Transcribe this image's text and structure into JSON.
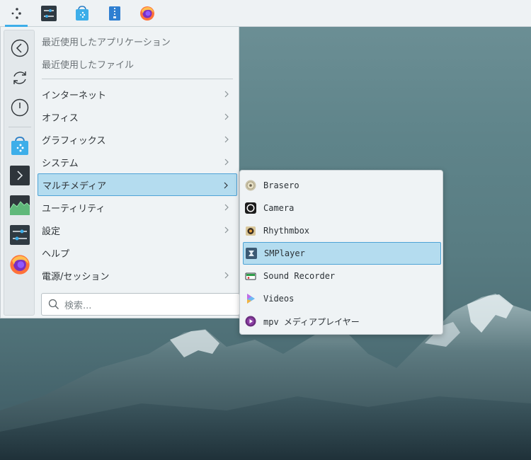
{
  "top_panel": {
    "icons": [
      "app-launcher-icon",
      "system-settings-icon",
      "discover-store-icon",
      "archive-icon",
      "firefox-icon"
    ]
  },
  "sidebar": {
    "icons": [
      "back-icon",
      "refresh-icon",
      "power-icon",
      "store-icon",
      "terminal-icon",
      "system-monitor-icon",
      "settings-icon",
      "firefox-icon"
    ]
  },
  "launcher": {
    "recent_apps": "最近使用したアプリケーション",
    "recent_files": "最近使用したファイル",
    "categories": [
      {
        "label": "インターネット"
      },
      {
        "label": "オフィス"
      },
      {
        "label": "グラフィックス"
      },
      {
        "label": "システム"
      },
      {
        "label": "マルチメディア"
      },
      {
        "label": "ユーティリティ"
      },
      {
        "label": "設定"
      },
      {
        "label": "ヘルプ"
      },
      {
        "label": "電源/セッション"
      }
    ],
    "search_placeholder": "検索..."
  },
  "submenu": {
    "items": [
      {
        "label": "Brasero",
        "icon": "brasero-icon"
      },
      {
        "label": "Camera",
        "icon": "camera-icon"
      },
      {
        "label": "Rhythmbox",
        "icon": "rhythmbox-icon"
      },
      {
        "label": "SMPlayer",
        "icon": "smplayer-icon"
      },
      {
        "label": "Sound Recorder",
        "icon": "sound-recorder-icon"
      },
      {
        "label": "Videos",
        "icon": "videos-icon"
      },
      {
        "label": "mpv メディアプレイヤー",
        "icon": "mpv-icon"
      }
    ]
  },
  "colors": {
    "accent": "#3daee9",
    "selection": "#b4dcef",
    "panel": "#eef2f4"
  }
}
